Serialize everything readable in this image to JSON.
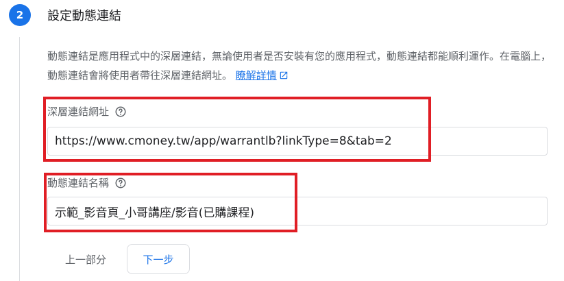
{
  "step": {
    "number": "2",
    "title": "設定動態連結"
  },
  "description": {
    "text": "動態連結是應用程式中的深層連結，無論使用者是否安裝有您的應用程式，動態連結都能順利運作。在電腦上，動態連結會將使用者帶往深層連結網址。",
    "learn_more": "瞭解詳情",
    "learn_more_icon": "open-in-new-icon"
  },
  "deep_link": {
    "label": "深層連結網址",
    "value": "https://www.cmoney.tw/app/warrantlb?linkType=8&tab=2",
    "help_icon": "help-circle-icon"
  },
  "link_name": {
    "label": "動態連結名稱",
    "value": "示範_影音頁_小哥講座/影音(已購課程)",
    "help_icon": "help-circle-icon"
  },
  "actions": {
    "back": "上一部分",
    "next": "下一步"
  },
  "colors": {
    "accent": "#1a73e8",
    "highlight_box": "#e01e25",
    "secondary_text": "#5f6368"
  }
}
